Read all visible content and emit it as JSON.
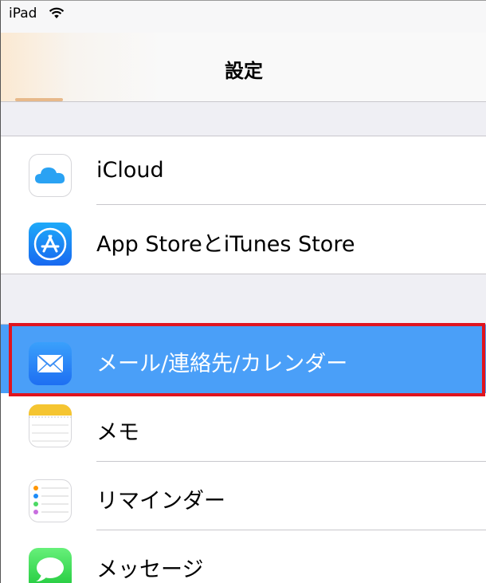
{
  "status_bar": {
    "carrier": "iPad",
    "wifi_icon": "wifi-icon"
  },
  "nav": {
    "title": "設定"
  },
  "groups": [
    {
      "items": [
        {
          "label": "iCloud",
          "icon": "icloud-icon",
          "icon_color": "#ffffff"
        },
        {
          "label": "App StoreとiTunes Store",
          "icon": "app-store-icon",
          "icon_color": "#1d8cf8"
        }
      ]
    },
    {
      "items": [
        {
          "label": "メール/連絡先/カレンダー",
          "icon": "mail-icon",
          "icon_color": "#2f87f5",
          "selected": true
        },
        {
          "label": "メモ",
          "icon": "notes-icon",
          "icon_color": "#f5c531"
        },
        {
          "label": "リマインダー",
          "icon": "reminders-icon",
          "icon_color": "#ffffff"
        },
        {
          "label": "メッセージ",
          "icon": "messages-icon",
          "icon_color": "#35d54a"
        }
      ]
    }
  ],
  "colors": {
    "selected_row": "#4a9ff8",
    "highlight_border": "#e0141e",
    "grouped_background": "#efeff4"
  }
}
